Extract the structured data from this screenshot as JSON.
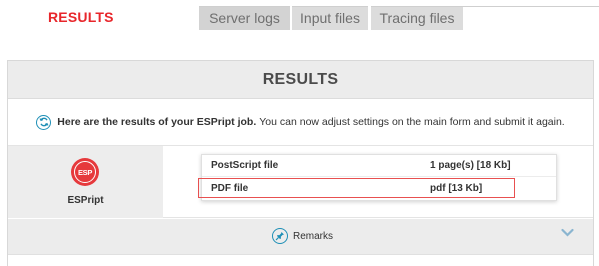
{
  "nav": {
    "results_label": "RESULTS",
    "tabs": [
      {
        "label": "Server logs"
      },
      {
        "label": "Input files"
      },
      {
        "label": "Tracing files"
      }
    ]
  },
  "panel": {
    "title": "RESULTS",
    "info": {
      "icon": "refresh-icon",
      "bold_text": "Here are the results of your ESPript job.",
      "text": "You can now adjust settings on the main form and submit it again."
    },
    "program": {
      "logo_text": "ESP",
      "name": "ESPript"
    },
    "files": [
      {
        "name": "PostScript file",
        "info": "1 page(s) [18 Kb]"
      },
      {
        "name": "PDF file",
        "info": "pdf [13 Kb]"
      }
    ],
    "remarks": {
      "icon": "pin-icon",
      "label": "Remarks",
      "toggle_icon": "chevron-down-icon"
    }
  },
  "colors": {
    "accent_red": "#e8262b",
    "logo_red": "#e6393c",
    "icon_blue": "#1e8fb6",
    "header_bg": "#ececec",
    "highlight_border": "#e85050"
  }
}
